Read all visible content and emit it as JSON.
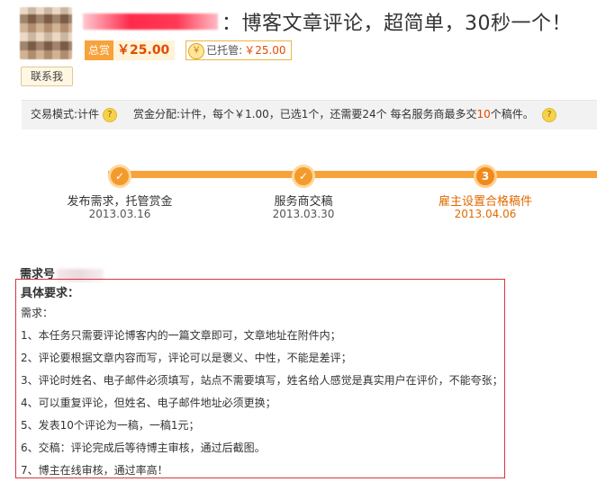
{
  "header": {
    "title": "：博客文章评论，超简单，30秒一个！",
    "contact_label": "联系我"
  },
  "bounty": {
    "total_label": "总赏",
    "total_amount": "￥25.00",
    "hosted_label": "已托管:",
    "hosted_amount": "￥25.00"
  },
  "mode_bar": {
    "trade_mode_label": "交易模式:",
    "trade_mode_value": "计件",
    "reward_label": "赏金分配:",
    "reward_prefix": "计件，每个￥1.00，已选1个，还需要24个 每名服务商最多交",
    "reward_max": "10",
    "reward_suffix": "个稿件。",
    "help_glyph": "?"
  },
  "progress": {
    "steps": [
      {
        "label": "发布需求，托管赏金",
        "date": "2013.03.16",
        "glyph": "✓"
      },
      {
        "label": "服务商交稿",
        "date": "2013.03.30",
        "glyph": "✓"
      },
      {
        "label": "雇主设置合格稿件",
        "date": "2013.04.06",
        "glyph": "3"
      }
    ],
    "colors": {
      "accent": "#f7a23a",
      "current": "#e06a00"
    }
  },
  "requirements": {
    "number_label": "需求号",
    "title": "具体要求：",
    "intro": "需求：",
    "items": [
      "1、本任务只需要评论博客内的一篇文章即可，文章地址在附件内；",
      "2、评论要根据文章内容而写，评论可以是褒义、中性，不能是差评；",
      "3、评论时姓名、电子邮件必须填写，站点不需要填写，姓名给人感觉是真实用户在评价，不能夸张；",
      "4、可以重复评论，但姓名、电子邮件地址必须更换；",
      "5、发表10个评论为一稿，一稿1元；",
      "6、交稿：评论完成后等待博主审核，通过后截图。",
      "7、博主在线审核，通过率高！"
    ]
  },
  "icons": {
    "yen": "￥",
    "check": "✓"
  }
}
